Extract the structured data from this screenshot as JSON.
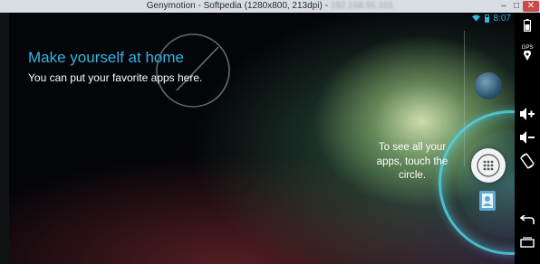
{
  "window": {
    "title": "Genymotion - Softpedia (1280x800, 213dpi) - ",
    "title_hidden_ip": "192.168.56.101",
    "minimize_label": "–",
    "maximize_label": "□",
    "close_label": "✕"
  },
  "status_bar": {
    "time": "8:07",
    "icons": [
      "wifi-icon",
      "battery-icon"
    ]
  },
  "guide": {
    "title": "Make yourself at home",
    "subtitle": "You can put your favorite apps here."
  },
  "cling": {
    "line1": "To see all your",
    "line2": "apps, touch the",
    "line3": "circle."
  },
  "side_toolbar": {
    "gps_label": "GPS",
    "buttons": [
      "battery-icon",
      "gps-icon",
      "volume-up-icon",
      "volume-down-icon",
      "rotate-icon",
      "back-icon",
      "recent-apps-icon"
    ]
  },
  "colors": {
    "accent": "#33b5e5",
    "cling_ring": "#50d2e6"
  }
}
